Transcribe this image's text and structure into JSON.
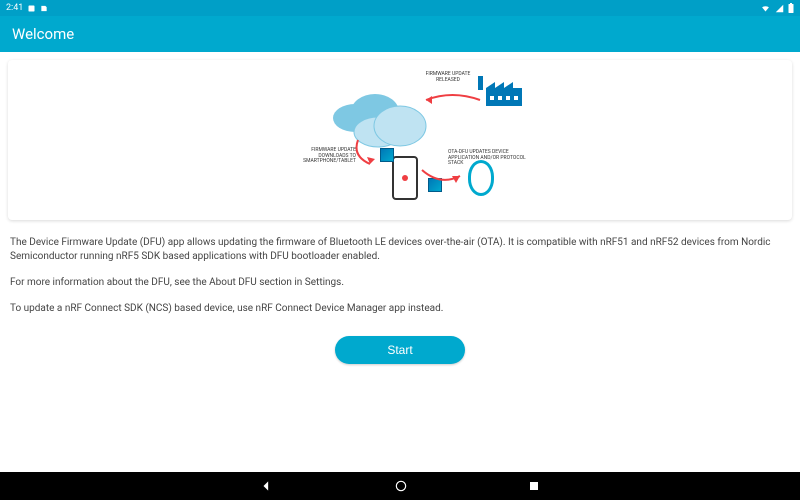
{
  "statusbar": {
    "time": "2:41",
    "left_icons": [
      "clock-icon",
      "sd-icon"
    ],
    "right_icons": [
      "wifi-icon",
      "signal-icon",
      "battery-icon"
    ]
  },
  "appbar": {
    "title": "Welcome"
  },
  "diagram": {
    "label_release": "FIRMWARE UPDATE RELEASED",
    "label_download": "FIRMWARE UPDATE DOWNLOADS TO SMARTPHONE/TABLET",
    "label_ota": "OTA-DFU UPDATES DEVICE APPLICATION AND/OR PROTOCOL STACK"
  },
  "body": {
    "p1": "The Device Firmware Update (DFU) app allows updating the firmware of Bluetooth LE devices over-the-air (OTA). It is compatible with nRF51 and nRF52 devices from Nordic Semiconductor running nRF5 SDK based applications with DFU bootloader enabled.",
    "p2": "For more information about the DFU, see the About DFU section in Settings.",
    "p3": "To update a nRF Connect SDK (NCS) based device, use nRF Connect Device Manager app instead."
  },
  "buttons": {
    "start": "Start"
  },
  "colors": {
    "primary": "#00a9ce"
  }
}
